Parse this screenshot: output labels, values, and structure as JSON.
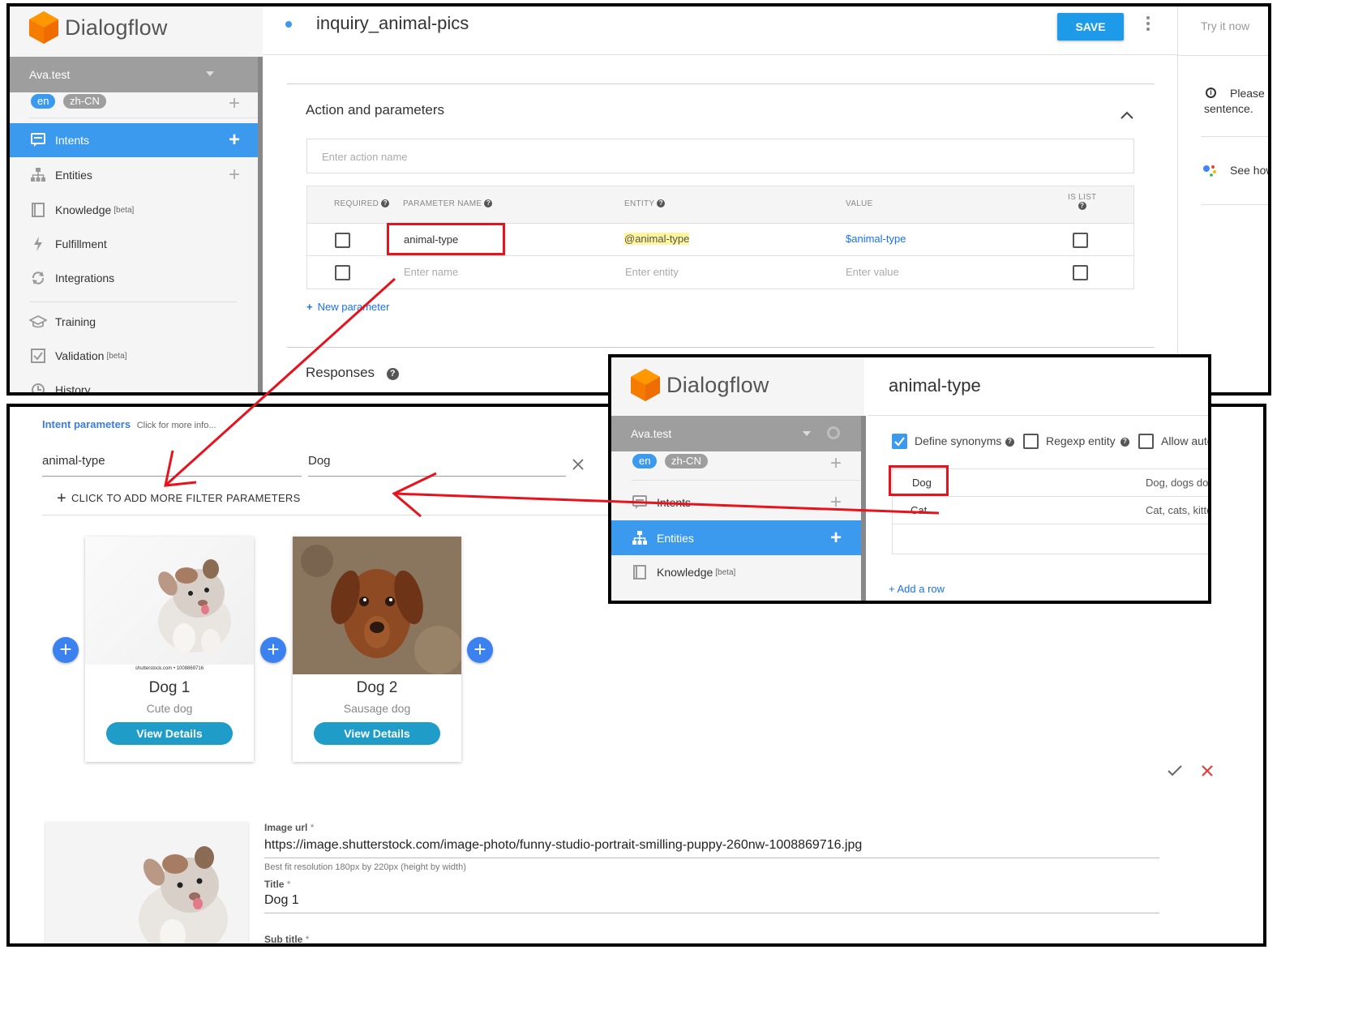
{
  "top": {
    "logo_text": "Dialogflow",
    "intent_name": "inquiry_animal-pics",
    "save_label": "SAVE",
    "try_it_label": "Try it now",
    "try_info_text1": "Please u",
    "try_info_text2": "sentence.",
    "see_how_text": "See how",
    "agent_name": "Ava.test",
    "langs": [
      "en",
      "zh-CN"
    ],
    "nav": [
      {
        "label": "Intents",
        "beta": ""
      },
      {
        "label": "Entities",
        "beta": ""
      },
      {
        "label": "Knowledge",
        "beta": "[beta]"
      },
      {
        "label": "Fulfillment",
        "beta": ""
      },
      {
        "label": "Integrations",
        "beta": ""
      },
      {
        "label": "Training",
        "beta": ""
      },
      {
        "label": "Validation",
        "beta": "[beta]"
      },
      {
        "label": "History",
        "beta": ""
      }
    ],
    "section_title": "Action and parameters",
    "action_placeholder": "Enter action name",
    "table_headers": {
      "required": "REQUIRED",
      "param_name": "PARAMETER NAME",
      "entity": "ENTITY",
      "value": "VALUE",
      "is_list": "IS LIST"
    },
    "row1": {
      "name": "animal-type",
      "entity": "@animal-type",
      "value": "$animal-type"
    },
    "row2": {
      "name": "Enter name",
      "entity": "Enter entity",
      "value": "Enter value"
    },
    "new_param": "New parameter",
    "responses_title": "Responses"
  },
  "bottom": {
    "intent_params_label": "Intent parameters",
    "click_more": "Click for more info...",
    "filter_param": "animal-type",
    "filter_value": "Dog",
    "add_filter": "CLICK TO ADD MORE FILTER PARAMETERS",
    "cards": [
      {
        "title": "Dog 1",
        "subtitle": "Cute dog",
        "button": "View Details",
        "watermark": "shutterstock.com • 1008869716"
      },
      {
        "title": "Dog 2",
        "subtitle": "Sausage dog",
        "button": "View Details",
        "watermark": ""
      }
    ],
    "image_url_label": "Image url",
    "image_url": "https://image.shutterstock.com/image-photo/funny-studio-portrait-smilling-puppy-260nw-1008869716.jpg",
    "best_fit": "Best fit resolution 180px by 220px (height by width)",
    "title_label": "Title",
    "title_value": "Dog 1",
    "subtitle_label": "Sub title",
    "required_mark": "*"
  },
  "overlay": {
    "logo_text": "Dialogflow",
    "entity_name": "animal-type",
    "agent_name": "Ava.test",
    "langs": [
      "en",
      "zh-CN"
    ],
    "nav": [
      {
        "label": "Intents",
        "beta": ""
      },
      {
        "label": "Entities",
        "beta": ""
      },
      {
        "label": "Knowledge",
        "beta": "[beta]"
      }
    ],
    "options": [
      "Define synonyms",
      "Regexp entity",
      "Allow auto"
    ],
    "rows": [
      {
        "value": "Dog",
        "synonyms": "Dog, dogs dog"
      },
      {
        "value": "Cat",
        "synonyms": "Cat, cats, kitte"
      }
    ],
    "add_row": "+ Add a row"
  },
  "colors": {
    "accent": "#3b99ee",
    "save": "#1e9be8",
    "red": "#e8121d",
    "button": "#1f9cc8"
  }
}
